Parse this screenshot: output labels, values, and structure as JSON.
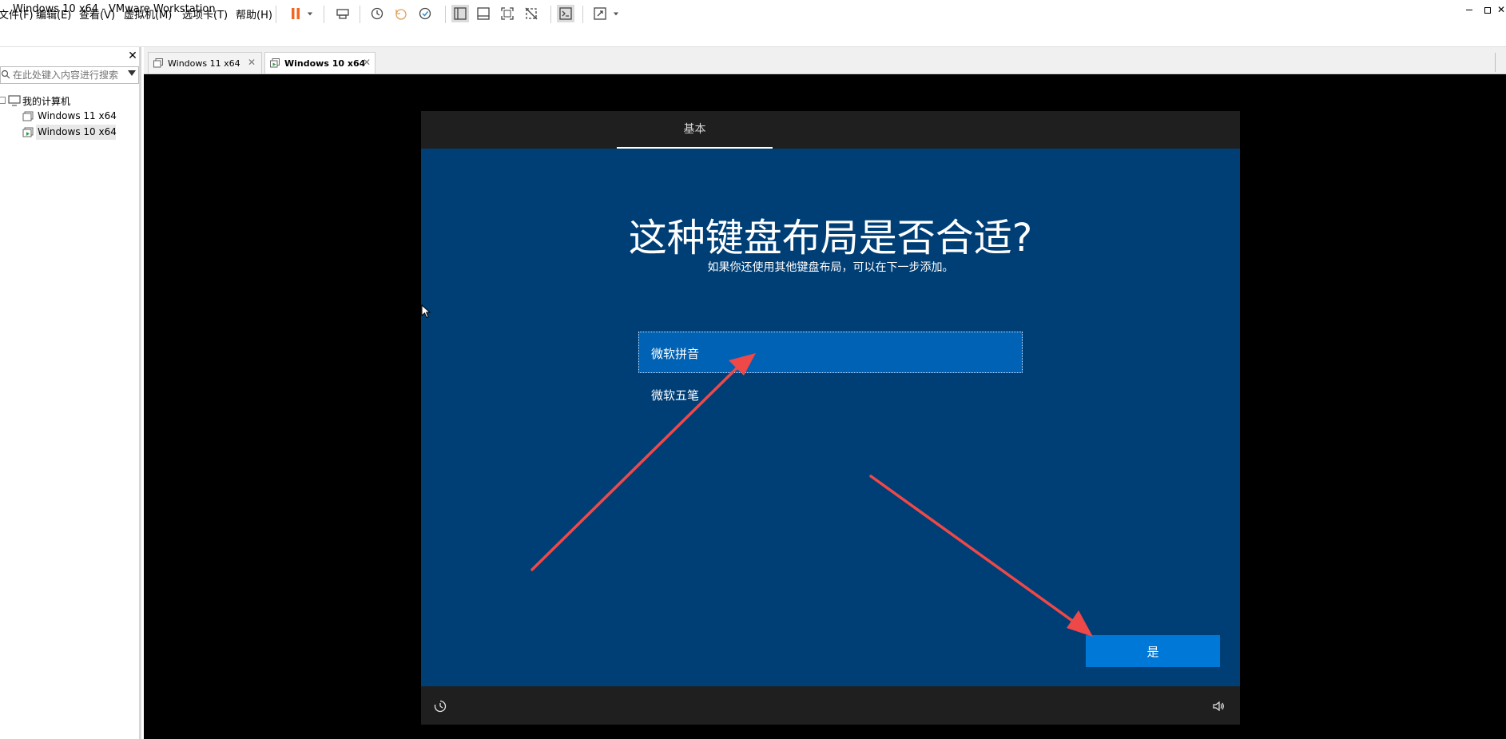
{
  "window": {
    "title": "Windows 10 x64 - VMware Workstation",
    "minimize": "▬",
    "maximize": "▢",
    "close": "✕"
  },
  "menu": {
    "items": [
      "文件(F)",
      "编辑(E)",
      "查看(V)",
      "虚拟机(M)",
      "选项卡(T)",
      "帮助(H)"
    ]
  },
  "sidebar": {
    "close_label": "✕",
    "search_placeholder": "在此处键入内容进行搜索",
    "root_label": "我的计算机",
    "vms": [
      "Windows 11 x64",
      "Windows 10 x64"
    ]
  },
  "tabs": [
    {
      "label": "Windows 11 x64",
      "active": false
    },
    {
      "label": "Windows 10 x64",
      "active": true
    }
  ],
  "tab_close": "✕",
  "oobe": {
    "section_tab": "基本",
    "heading": "这种键盘布局是否合适?",
    "subheading": "如果你还使用其他键盘布局，可以在下一步添加。",
    "options": [
      "微软拼音",
      "微软五笔"
    ],
    "selected_index": 0,
    "yes_button": "是"
  },
  "colors": {
    "oobe_background": "#003f76",
    "selected_option": "#0062b4",
    "yes_button": "#0078d7",
    "annotation_arrow": "#ef4848",
    "pause_accent": "#f26522"
  }
}
